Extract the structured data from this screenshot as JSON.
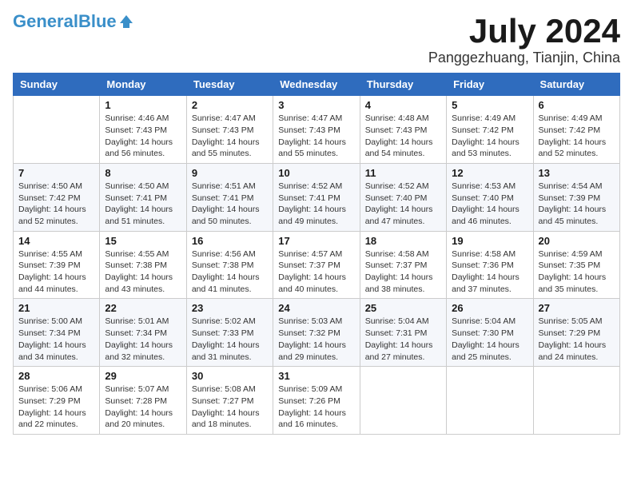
{
  "header": {
    "logo_line1": "General",
    "logo_line2": "Blue",
    "month": "July 2024",
    "location": "Panggezhuang, Tianjin, China"
  },
  "weekdays": [
    "Sunday",
    "Monday",
    "Tuesday",
    "Wednesday",
    "Thursday",
    "Friday",
    "Saturday"
  ],
  "weeks": [
    [
      {
        "day": "",
        "sunrise": "",
        "sunset": "",
        "daylight": ""
      },
      {
        "day": "1",
        "sunrise": "4:46 AM",
        "sunset": "7:43 PM",
        "daylight": "14 hours and 56 minutes."
      },
      {
        "day": "2",
        "sunrise": "4:47 AM",
        "sunset": "7:43 PM",
        "daylight": "14 hours and 55 minutes."
      },
      {
        "day": "3",
        "sunrise": "4:47 AM",
        "sunset": "7:43 PM",
        "daylight": "14 hours and 55 minutes."
      },
      {
        "day": "4",
        "sunrise": "4:48 AM",
        "sunset": "7:43 PM",
        "daylight": "14 hours and 54 minutes."
      },
      {
        "day": "5",
        "sunrise": "4:49 AM",
        "sunset": "7:42 PM",
        "daylight": "14 hours and 53 minutes."
      },
      {
        "day": "6",
        "sunrise": "4:49 AM",
        "sunset": "7:42 PM",
        "daylight": "14 hours and 52 minutes."
      }
    ],
    [
      {
        "day": "7",
        "sunrise": "4:50 AM",
        "sunset": "7:42 PM",
        "daylight": "14 hours and 52 minutes."
      },
      {
        "day": "8",
        "sunrise": "4:50 AM",
        "sunset": "7:41 PM",
        "daylight": "14 hours and 51 minutes."
      },
      {
        "day": "9",
        "sunrise": "4:51 AM",
        "sunset": "7:41 PM",
        "daylight": "14 hours and 50 minutes."
      },
      {
        "day": "10",
        "sunrise": "4:52 AM",
        "sunset": "7:41 PM",
        "daylight": "14 hours and 49 minutes."
      },
      {
        "day": "11",
        "sunrise": "4:52 AM",
        "sunset": "7:40 PM",
        "daylight": "14 hours and 47 minutes."
      },
      {
        "day": "12",
        "sunrise": "4:53 AM",
        "sunset": "7:40 PM",
        "daylight": "14 hours and 46 minutes."
      },
      {
        "day": "13",
        "sunrise": "4:54 AM",
        "sunset": "7:39 PM",
        "daylight": "14 hours and 45 minutes."
      }
    ],
    [
      {
        "day": "14",
        "sunrise": "4:55 AM",
        "sunset": "7:39 PM",
        "daylight": "14 hours and 44 minutes."
      },
      {
        "day": "15",
        "sunrise": "4:55 AM",
        "sunset": "7:38 PM",
        "daylight": "14 hours and 43 minutes."
      },
      {
        "day": "16",
        "sunrise": "4:56 AM",
        "sunset": "7:38 PM",
        "daylight": "14 hours and 41 minutes."
      },
      {
        "day": "17",
        "sunrise": "4:57 AM",
        "sunset": "7:37 PM",
        "daylight": "14 hours and 40 minutes."
      },
      {
        "day": "18",
        "sunrise": "4:58 AM",
        "sunset": "7:37 PM",
        "daylight": "14 hours and 38 minutes."
      },
      {
        "day": "19",
        "sunrise": "4:58 AM",
        "sunset": "7:36 PM",
        "daylight": "14 hours and 37 minutes."
      },
      {
        "day": "20",
        "sunrise": "4:59 AM",
        "sunset": "7:35 PM",
        "daylight": "14 hours and 35 minutes."
      }
    ],
    [
      {
        "day": "21",
        "sunrise": "5:00 AM",
        "sunset": "7:34 PM",
        "daylight": "14 hours and 34 minutes."
      },
      {
        "day": "22",
        "sunrise": "5:01 AM",
        "sunset": "7:34 PM",
        "daylight": "14 hours and 32 minutes."
      },
      {
        "day": "23",
        "sunrise": "5:02 AM",
        "sunset": "7:33 PM",
        "daylight": "14 hours and 31 minutes."
      },
      {
        "day": "24",
        "sunrise": "5:03 AM",
        "sunset": "7:32 PM",
        "daylight": "14 hours and 29 minutes."
      },
      {
        "day": "25",
        "sunrise": "5:04 AM",
        "sunset": "7:31 PM",
        "daylight": "14 hours and 27 minutes."
      },
      {
        "day": "26",
        "sunrise": "5:04 AM",
        "sunset": "7:30 PM",
        "daylight": "14 hours and 25 minutes."
      },
      {
        "day": "27",
        "sunrise": "5:05 AM",
        "sunset": "7:29 PM",
        "daylight": "14 hours and 24 minutes."
      }
    ],
    [
      {
        "day": "28",
        "sunrise": "5:06 AM",
        "sunset": "7:29 PM",
        "daylight": "14 hours and 22 minutes."
      },
      {
        "day": "29",
        "sunrise": "5:07 AM",
        "sunset": "7:28 PM",
        "daylight": "14 hours and 20 minutes."
      },
      {
        "day": "30",
        "sunrise": "5:08 AM",
        "sunset": "7:27 PM",
        "daylight": "14 hours and 18 minutes."
      },
      {
        "day": "31",
        "sunrise": "5:09 AM",
        "sunset": "7:26 PM",
        "daylight": "14 hours and 16 minutes."
      },
      {
        "day": "",
        "sunrise": "",
        "sunset": "",
        "daylight": ""
      },
      {
        "day": "",
        "sunrise": "",
        "sunset": "",
        "daylight": ""
      },
      {
        "day": "",
        "sunrise": "",
        "sunset": "",
        "daylight": ""
      }
    ]
  ]
}
